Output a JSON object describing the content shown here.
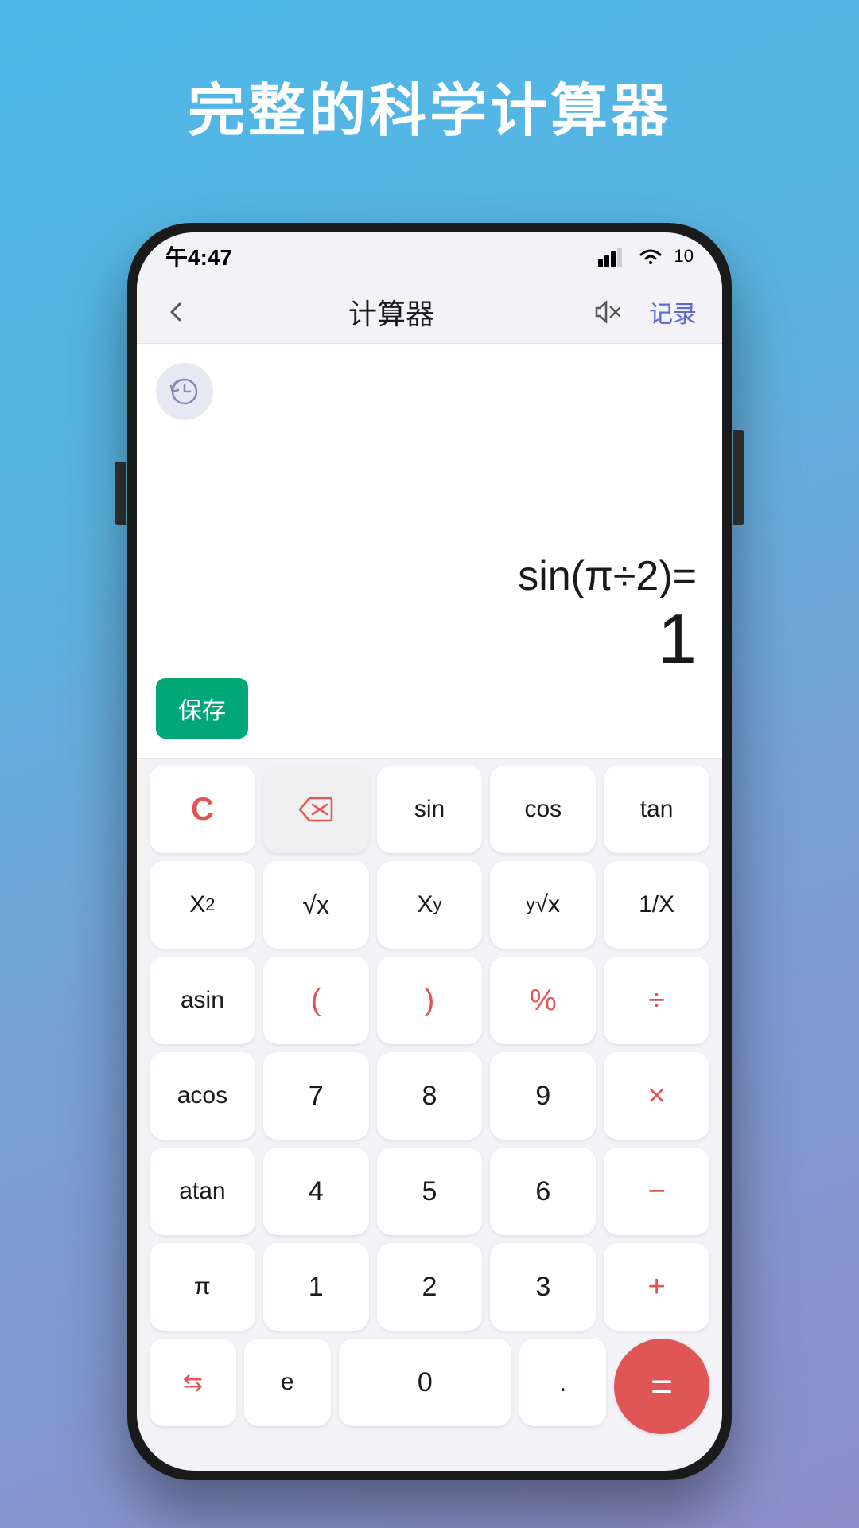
{
  "page": {
    "background_title": "完整的科学计算器",
    "status": {
      "time": "午4:47",
      "battery": "10"
    },
    "header": {
      "title": "计算器",
      "record_label": "记录"
    },
    "display": {
      "expression": "sin(π÷2)=",
      "result": "1",
      "save_label": "保存"
    },
    "keys": {
      "row1": [
        "C",
        "⌫",
        "sin",
        "cos",
        "tan"
      ],
      "row2": [
        "X²",
        "√x",
        "Xʸ",
        "ʸ√x",
        "1/X"
      ],
      "row3": [
        "asin",
        "(",
        ")",
        "%",
        "÷"
      ],
      "row4": [
        "acos",
        "7",
        "8",
        "9",
        "×"
      ],
      "row5": [
        "atan",
        "4",
        "5",
        "6",
        "−"
      ],
      "row6": [
        "π",
        "1",
        "2",
        "3",
        "+"
      ],
      "row7": [
        "⇆",
        "e",
        "0",
        ".",
        "="
      ]
    }
  }
}
